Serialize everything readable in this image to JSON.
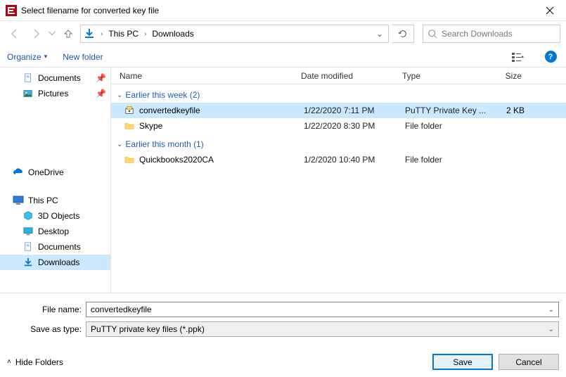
{
  "window": {
    "title": "Select filename for converted key file"
  },
  "breadcrumb": {
    "root": "This PC",
    "folder": "Downloads"
  },
  "search": {
    "placeholder": "Search Downloads"
  },
  "toolbar": {
    "organize": "Organize",
    "newfolder": "New folder"
  },
  "sidebar": {
    "documents": "Documents",
    "pictures": "Pictures",
    "onedrive": "OneDrive",
    "thispc": "This PC",
    "objects3d": "3D Objects",
    "desktop": "Desktop",
    "documents2": "Documents",
    "downloads": "Downloads"
  },
  "columns": {
    "name": "Name",
    "date": "Date modified",
    "type": "Type",
    "size": "Size"
  },
  "groups": {
    "week": "Earlier this week (2)",
    "month": "Earlier this month (1)"
  },
  "files": {
    "f1": {
      "name": "convertedkeyfile",
      "date": "1/22/2020 7:11 PM",
      "type": "PuTTY Private Key ...",
      "size": "2 KB"
    },
    "f2": {
      "name": "Skype",
      "date": "1/22/2020 8:30 PM",
      "type": "File folder",
      "size": ""
    },
    "f3": {
      "name": "Quickbooks2020CA",
      "date": "1/2/2020 10:40 PM",
      "type": "File folder",
      "size": ""
    }
  },
  "form": {
    "filename_label": "File name:",
    "filename_value": "convertedkeyfile",
    "savetype_label": "Save as type:",
    "savetype_value": "PuTTY private key files (*.ppk)"
  },
  "footer": {
    "hide": "Hide Folders",
    "save": "Save",
    "cancel": "Cancel"
  }
}
